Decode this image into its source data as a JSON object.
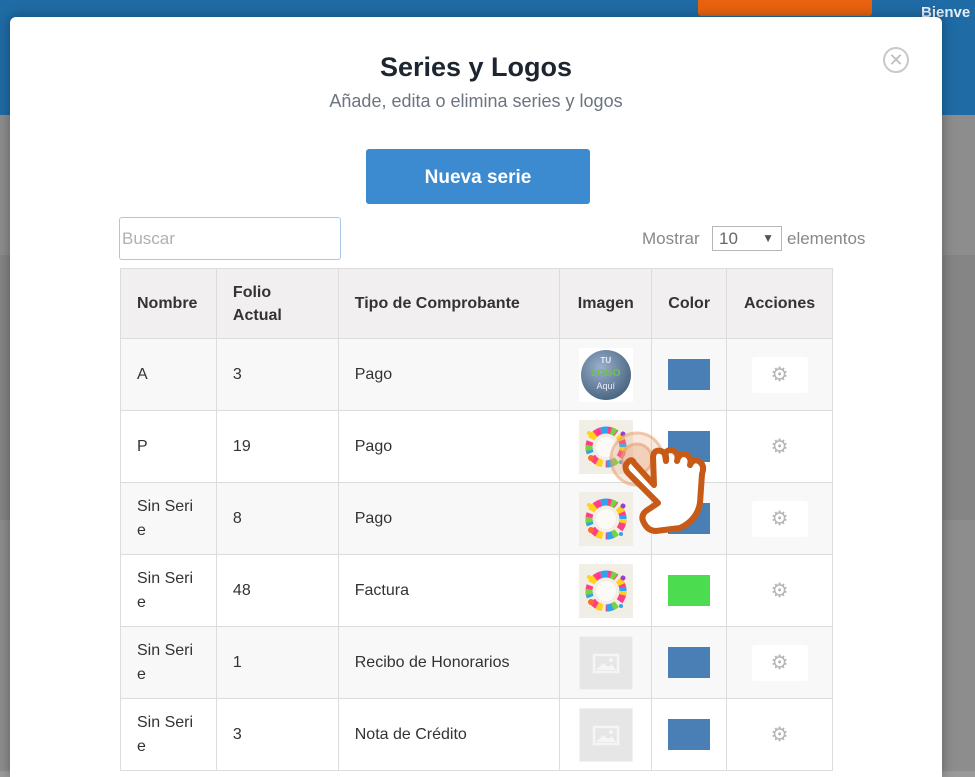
{
  "background": {
    "welcome_text": "Bienve"
  },
  "modal": {
    "title": "Series y Logos",
    "subtitle": "Añade, edita o elimina series y logos",
    "close_icon": "close-circle-icon",
    "new_button_label": "Nueva serie"
  },
  "search": {
    "placeholder": "Buscar",
    "value": ""
  },
  "page_size": {
    "prefix": "Mostrar",
    "selected": "10",
    "suffix": "elementos"
  },
  "table": {
    "headers": [
      "Nombre",
      "Folio Actual",
      "Tipo de Comprobante",
      "Imagen",
      "Color",
      "Acciones"
    ],
    "rows": [
      {
        "nombre": "A",
        "folio": "3",
        "tipo": "Pago",
        "image": "logo-tu-logo-aqui",
        "color": "#4a7fb6",
        "action_icon": "gear-icon"
      },
      {
        "nombre": "P",
        "folio": "19",
        "tipo": "Pago",
        "image": "logo-color-splash",
        "color": "#4a7fb6",
        "action_icon": "gear-icon"
      },
      {
        "nombre": "Sin Serie",
        "folio": "8",
        "tipo": "Pago",
        "image": "logo-color-splash",
        "color": "#4a7fb6",
        "action_icon": "gear-icon"
      },
      {
        "nombre": "Sin Serie",
        "folio": "48",
        "tipo": "Factura",
        "image": "logo-color-splash",
        "color": "#4cdc50",
        "action_icon": "gear-icon"
      },
      {
        "nombre": "Sin Serie",
        "folio": "1",
        "tipo": "Recibo de Honorarios",
        "image": "image-placeholder-icon",
        "color": "#4a7fb6",
        "action_icon": "gear-icon"
      },
      {
        "nombre": "Sin Serie",
        "folio": "3",
        "tipo": "Nota de Crédito",
        "image": "image-placeholder-icon",
        "color": "#4a7fb6",
        "action_icon": "gear-icon"
      }
    ]
  },
  "logo_text": {
    "line1": "TU",
    "line2": "LOGO",
    "line3": "Aquí"
  },
  "colors": {
    "primary": "#3c8ad0",
    "header_bg": "#1f6ba5",
    "accent_orange": "#e8620f",
    "hand_cursor": "#c85a17"
  }
}
